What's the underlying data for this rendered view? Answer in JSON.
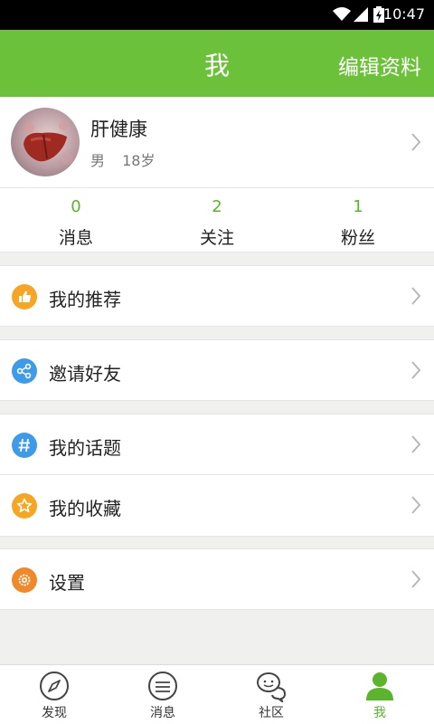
{
  "status_bar": {
    "time": "10:47"
  },
  "header": {
    "title": "我",
    "edit_label": "编辑资料"
  },
  "profile": {
    "name": "肝健康",
    "gender": "男",
    "age": "18岁"
  },
  "stats": [
    {
      "value": "0",
      "label": "消息"
    },
    {
      "value": "2",
      "label": "关注"
    },
    {
      "value": "1",
      "label": "粉丝"
    }
  ],
  "menu": {
    "recommend": "我的推荐",
    "invite": "邀请好友",
    "topics": "我的话题",
    "favorites": "我的收藏",
    "settings": "设置"
  },
  "tabs": [
    {
      "label": "发现",
      "icon": "compass-icon"
    },
    {
      "label": "消息",
      "icon": "message-icon"
    },
    {
      "label": "社区",
      "icon": "chat-bubbles-icon"
    },
    {
      "label": "我",
      "icon": "person-icon"
    }
  ],
  "colors": {
    "accent": "#6cc13b",
    "active_text": "#5ab42c",
    "orange": "#f5a623",
    "blue": "#3d9be9",
    "settings_orange": "#f0892a"
  }
}
